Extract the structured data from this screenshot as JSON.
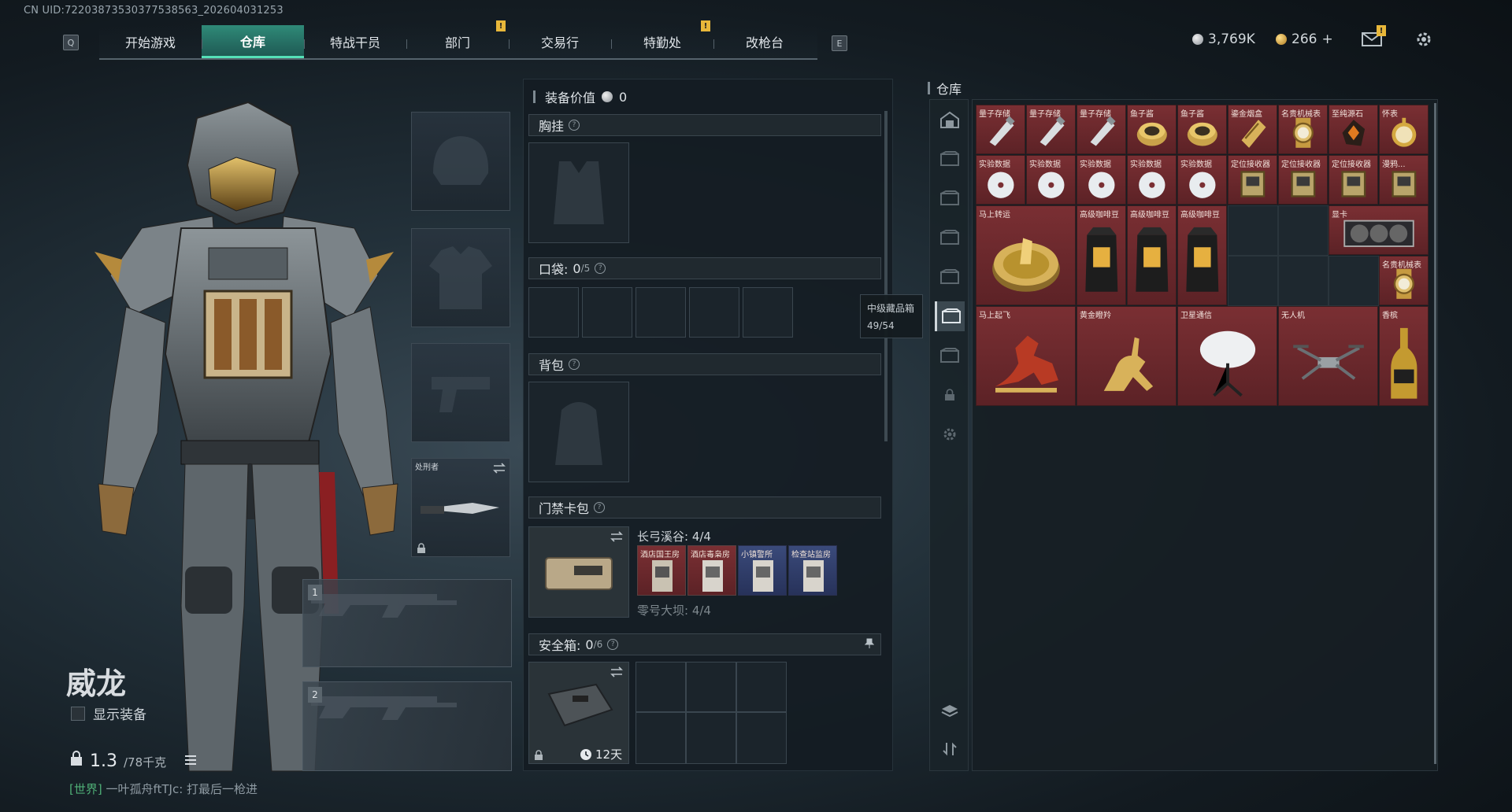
{
  "uid": "CN UID:72203873530377538563_202604031253",
  "nav": {
    "left_key": "Q",
    "right_key": "E",
    "tabs": [
      {
        "label": "开始游戏",
        "active": false,
        "badge": ""
      },
      {
        "label": "仓库",
        "active": true,
        "badge": ""
      },
      {
        "label": "特战干员",
        "active": false,
        "badge": ""
      },
      {
        "label": "部门",
        "active": false,
        "badge": "!"
      },
      {
        "label": "交易行",
        "active": false,
        "badge": ""
      },
      {
        "label": "特勤处",
        "active": false,
        "badge": "!"
      },
      {
        "label": "改枪台",
        "active": false,
        "badge": ""
      }
    ]
  },
  "currency": {
    "silver": "3,769K",
    "gold": "266",
    "gold_add": "+"
  },
  "mail_badge": "!",
  "operator": {
    "name": "威龙",
    "show_equipment_label": "显示装备",
    "weight": "1.3",
    "weight_max": "/78千克",
    "chat": {
      "channel": "[世界]",
      "text": "一叶孤舟ftTJc: 打最后一枪进"
    }
  },
  "slots": {
    "melee_name": "处刑者",
    "weapon1_tag": "1",
    "weapon2_tag": "2"
  },
  "center": {
    "value_label": "装备价值",
    "value": "0",
    "chest_rig": "胸挂",
    "pockets": "口袋:",
    "pockets_count": "0",
    "pockets_max": "/5",
    "backpack": "背包",
    "keycard": "门禁卡包",
    "map1": "长弓溪谷: 4/4",
    "map2": "零号大坝: 4/4",
    "cards": [
      "酒店国王房",
      "酒店毒枭房",
      "小镇警所",
      "检查站监房"
    ],
    "safe_box": "安全箱:",
    "safe_count": "0",
    "safe_max": "/6",
    "safe_timer": "12天"
  },
  "tooltip": {
    "title": "中级藏品箱",
    "count": "49/54"
  },
  "warehouse": {
    "title": "仓库",
    "items": [
      {
        "name": "量子存储",
        "icon": "usb-drive"
      },
      {
        "name": "量子存储",
        "icon": "usb-drive"
      },
      {
        "name": "量子存储",
        "icon": "usb-drive"
      },
      {
        "name": "鱼子酱",
        "icon": "tin"
      },
      {
        "name": "鱼子酱",
        "icon": "tin"
      },
      {
        "name": "鎏金烟盒",
        "icon": "case"
      },
      {
        "name": "名贵机械表",
        "icon": "watch"
      },
      {
        "name": "至纯源石",
        "icon": "ore"
      },
      {
        "name": "怀表",
        "icon": "pocket-watch"
      },
      {
        "name": "实验数据",
        "icon": "disc"
      },
      {
        "name": "实验数据",
        "icon": "disc"
      },
      {
        "name": "实验数据",
        "icon": "disc"
      },
      {
        "name": "实验数据",
        "icon": "disc"
      },
      {
        "name": "实验数据",
        "icon": "disc"
      },
      {
        "name": "定位接收器",
        "icon": "device"
      },
      {
        "name": "定位接收器",
        "icon": "device"
      },
      {
        "name": "定位接收器",
        "icon": "device"
      },
      {
        "name": "漫鸦...",
        "icon": "device"
      },
      {
        "name": "马上转运",
        "icon": "wheel"
      },
      {
        "name": "高级咖啡豆",
        "icon": "coffee"
      },
      {
        "name": "高级咖啡豆",
        "icon": "coffee"
      },
      {
        "name": "高级咖啡豆",
        "icon": "coffee"
      },
      {
        "name": "显卡",
        "icon": "gpu"
      },
      {
        "name": "名贵机械表",
        "icon": "watch"
      },
      {
        "name": "马上起飞",
        "icon": "horse"
      },
      {
        "name": "黄金瞪羚",
        "icon": "gazelle"
      },
      {
        "name": "卫星通信",
        "icon": "satellite"
      },
      {
        "name": "无人机",
        "icon": "drone"
      },
      {
        "name": "香槟",
        "icon": "bottle"
      }
    ]
  }
}
